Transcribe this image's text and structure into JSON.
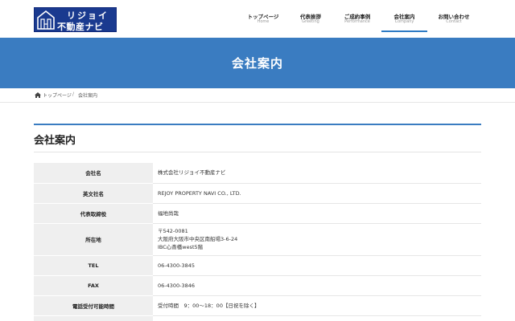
{
  "logo": {
    "line1": "リジョイ",
    "line2": "不動産ナビ"
  },
  "nav": [
    {
      "jp": "トップページ",
      "en": "Home"
    },
    {
      "jp": "代表挨拶",
      "en": "Greeting"
    },
    {
      "jp": "ご成約事例",
      "en": "Performance"
    },
    {
      "jp": "会社案内",
      "en": "Company"
    },
    {
      "jp": "お問い合わせ",
      "en": "Contact"
    }
  ],
  "hero": {
    "title": "会社案内"
  },
  "breadcrumb": {
    "home": "トップページ",
    "separator": "/",
    "current": "会社案内"
  },
  "section": {
    "title": "会社案内"
  },
  "table": [
    {
      "label": "会社名",
      "value": "株式会社リジョイ不動産ナビ"
    },
    {
      "label": "英文社名",
      "value": "REJOY PROPERTY NAVI CO., LTD."
    },
    {
      "label": "代表取締役",
      "value": "福地尚哉"
    },
    {
      "label": "所在地",
      "value_lines": [
        "〒542-0081",
        "大阪府大阪市中央区南船場3-6-24",
        "IBC心斎橋west5階"
      ]
    },
    {
      "label": "TEL",
      "value": "06-4300-3845"
    },
    {
      "label": "FAX",
      "value": "06-4300-3846"
    },
    {
      "label": "電話受付可能時間",
      "value": "受付時間　9：00〜18：00【日祝を除く】"
    }
  ],
  "colors": {
    "brand": "#1a3a8f",
    "accent": "#3a7cc1",
    "label_bg": "#efefef"
  },
  "icons": {
    "logo": "house-logo-icon",
    "breadcrumb": "home-icon"
  }
}
